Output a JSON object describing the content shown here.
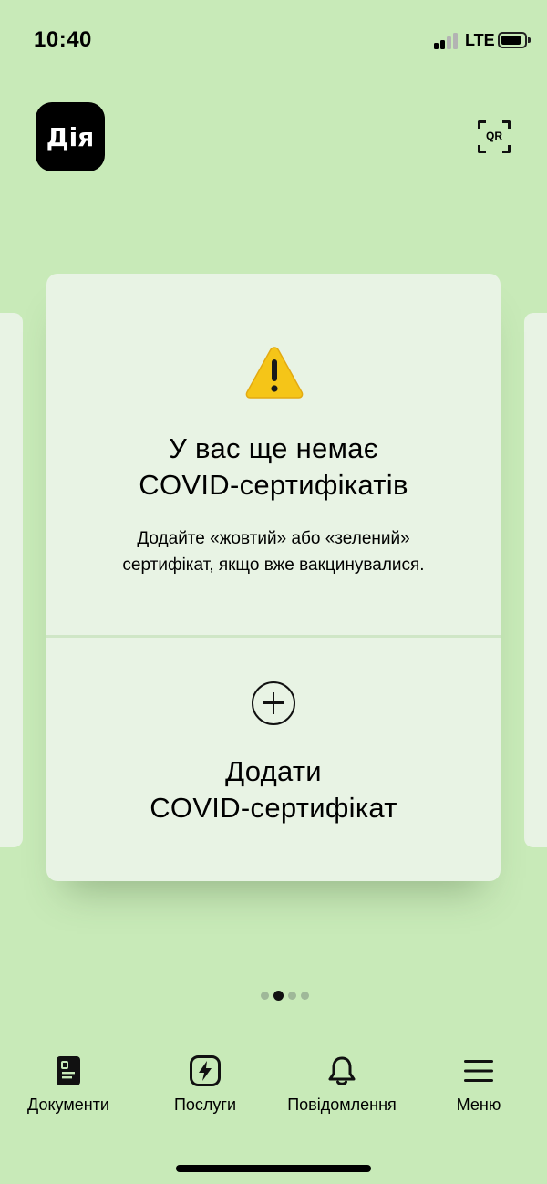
{
  "status_bar": {
    "time": "10:40",
    "network": "LTE",
    "signal_bars_active": 2,
    "signal_bars_total": 4,
    "battery_level": 0.75
  },
  "header": {
    "logo_text": "Дія",
    "qr_label": "QR",
    "qr_icon": "qr-scan-icon"
  },
  "carousel": {
    "total_pages": 4,
    "active_page": 1
  },
  "card": {
    "icon": "warning-icon",
    "title_line1": "У вас ще немає",
    "title_line2": "COVID-сертифікатів",
    "description_line1": "Додайте «жовтий» або «зелений»",
    "description_line2": "сертифікат, якщо вже вакцинувалися.",
    "add_icon": "plus-circle-icon",
    "add_label_line1": "Додати",
    "add_label_line2": "COVID-сертифікат"
  },
  "tabs": [
    {
      "label": "Документи",
      "icon": "document-icon"
    },
    {
      "label": "Послуги",
      "icon": "lightning-icon"
    },
    {
      "label": "Повідомлення",
      "icon": "bell-icon"
    },
    {
      "label": "Меню",
      "icon": "menu-icon"
    }
  ],
  "colors": {
    "background": "#c8eab8",
    "card": "#e8f3e4",
    "warning": "#f5c518",
    "text": "#000000"
  }
}
